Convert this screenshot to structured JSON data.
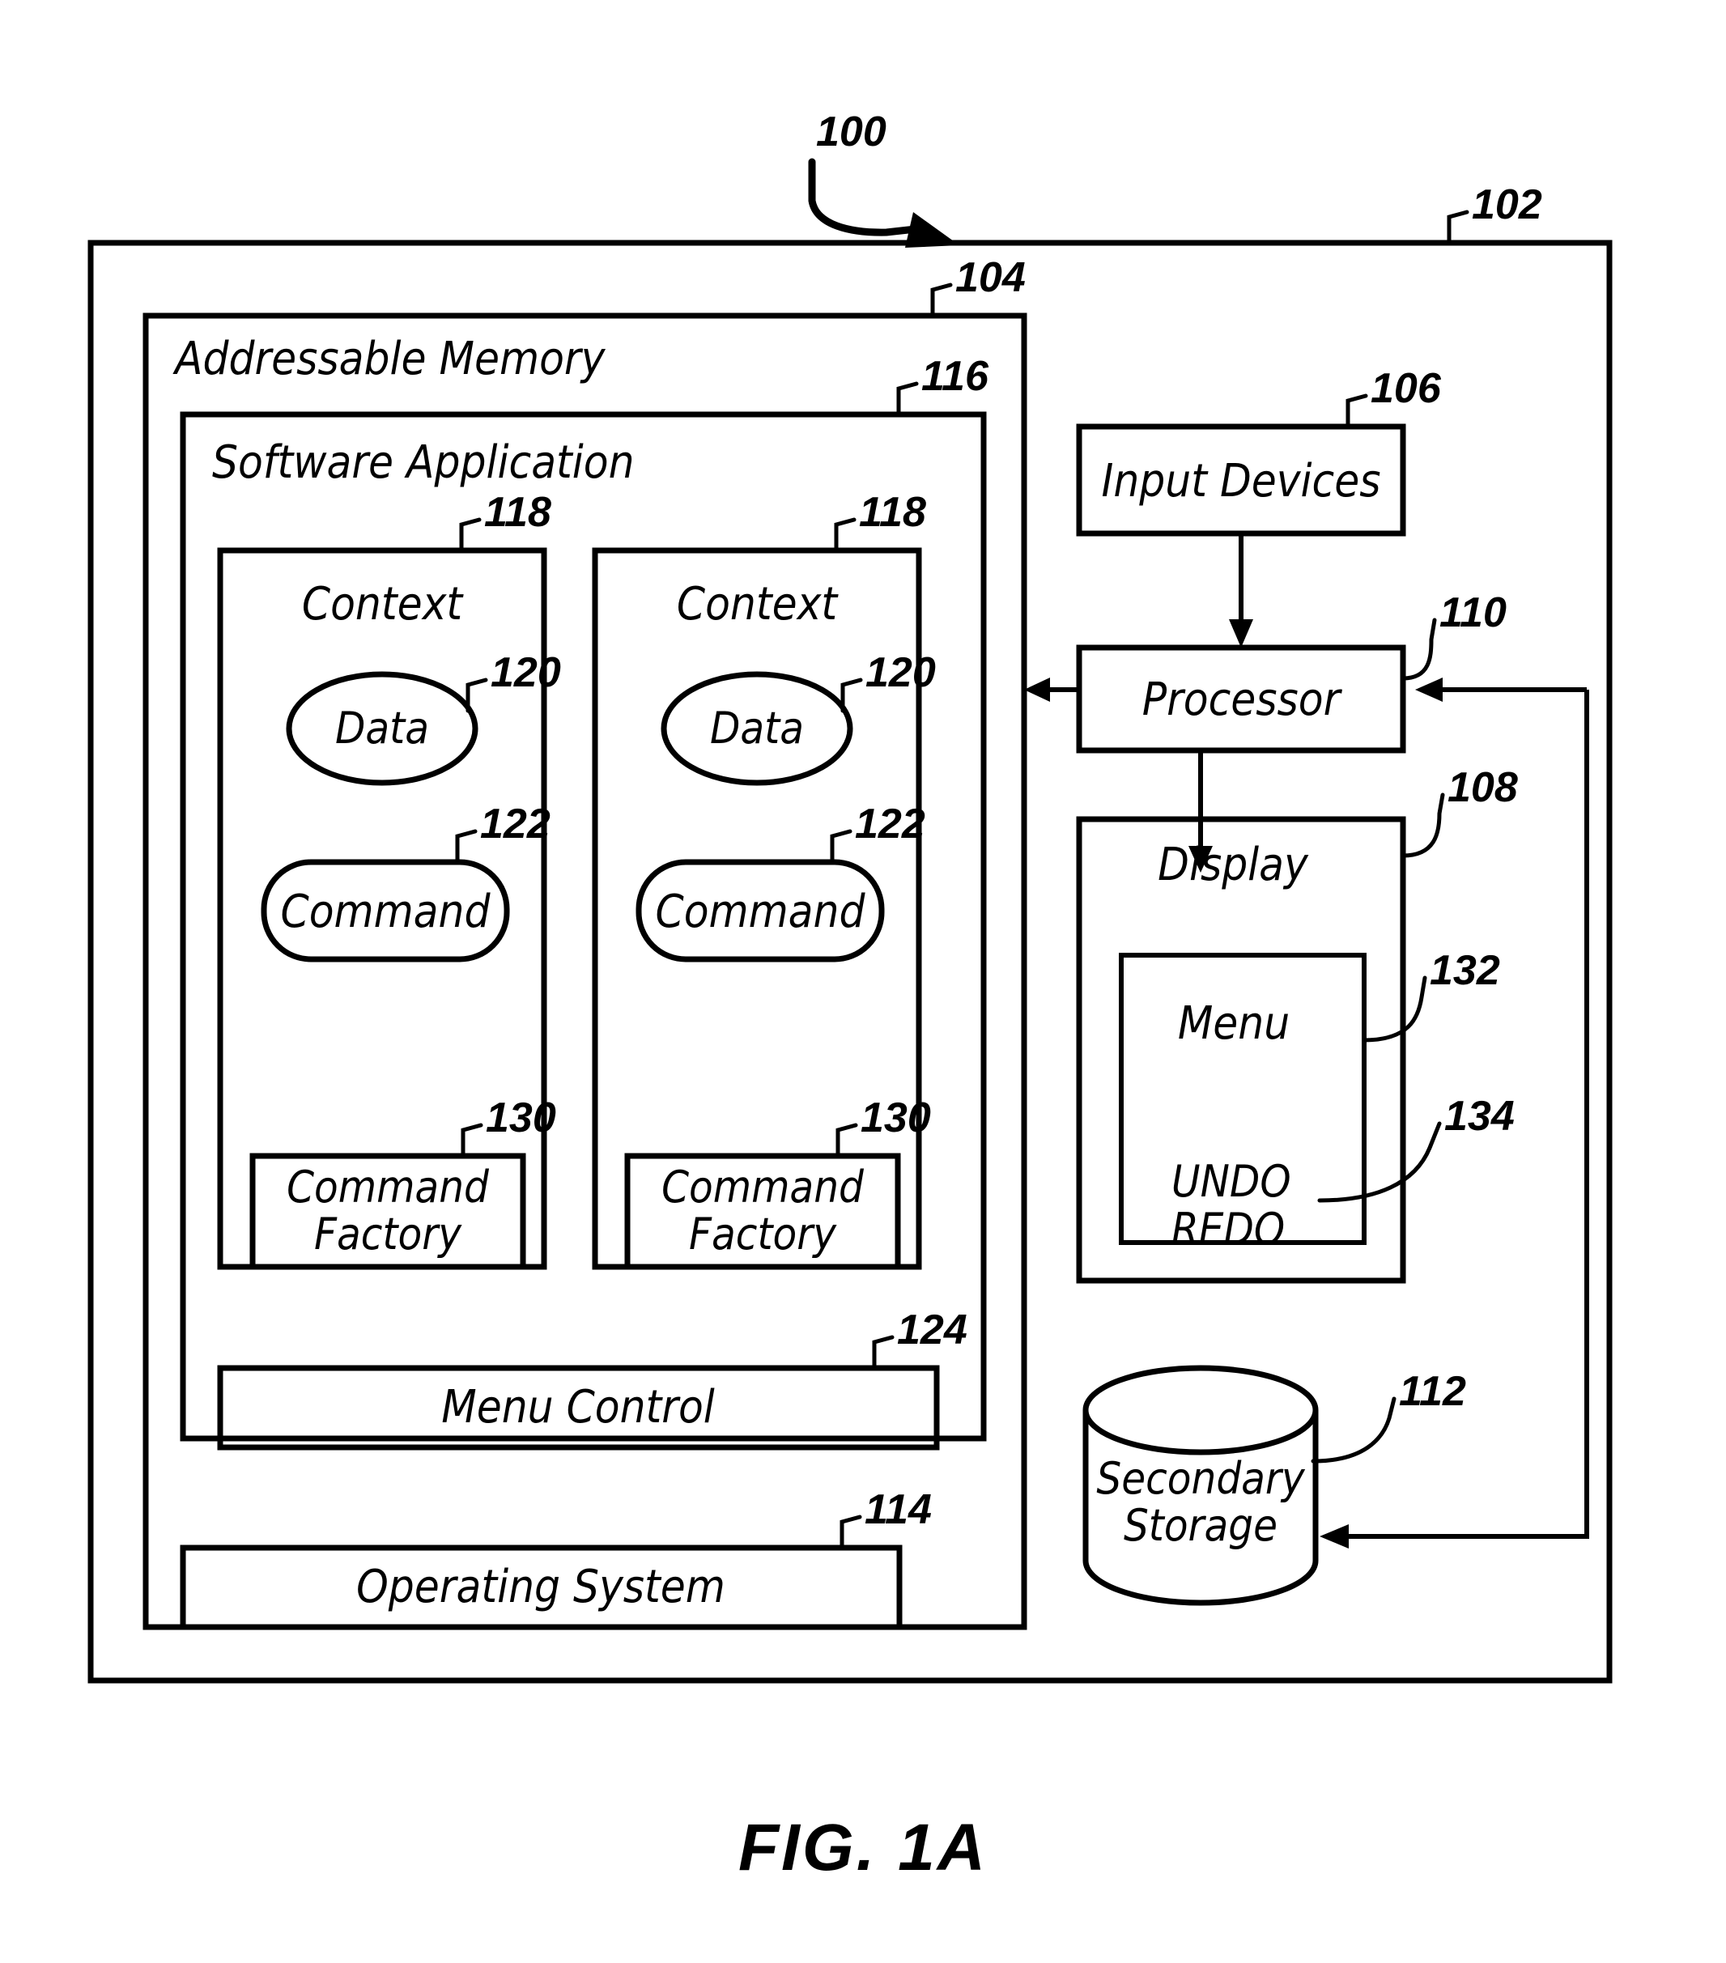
{
  "figure": {
    "caption": "FIG. 1A",
    "system_ref": "100"
  },
  "blocks": {
    "system": {
      "ref": "102",
      "label": ""
    },
    "addressable_memory": {
      "ref": "104",
      "label": "Addressable Memory"
    },
    "software_application": {
      "ref": "116",
      "label": "Software Application"
    },
    "context_left": {
      "ref": "118",
      "label": "Context",
      "data": {
        "ref": "120",
        "label": "Data"
      },
      "command": {
        "ref": "122",
        "label": "Command"
      },
      "command_factory": {
        "ref": "130",
        "label_line1": "Command",
        "label_line2": "Factory"
      }
    },
    "context_right": {
      "ref": "118",
      "label": "Context",
      "data": {
        "ref": "120",
        "label": "Data"
      },
      "command": {
        "ref": "122",
        "label": "Command"
      },
      "command_factory": {
        "ref": "130",
        "label_line1": "Command",
        "label_line2": "Factory"
      }
    },
    "menu_control": {
      "ref": "124",
      "label": "Menu Control"
    },
    "operating_system": {
      "ref": "114",
      "label": "Operating System"
    },
    "input_devices": {
      "ref": "106",
      "label": "Input Devices"
    },
    "processor": {
      "ref": "110",
      "label": "Processor"
    },
    "display": {
      "ref": "108",
      "label": "Display"
    },
    "menu": {
      "ref": "132",
      "label": "Menu"
    },
    "undo_redo": {
      "ref": "134",
      "label_line1": "UNDO",
      "label_line2": "REDO"
    },
    "secondary_storage": {
      "ref": "112",
      "label_line1": "Secondary",
      "label_line2": "Storage"
    }
  },
  "colors": {
    "ink": "#000000",
    "paper": "#ffffff"
  }
}
